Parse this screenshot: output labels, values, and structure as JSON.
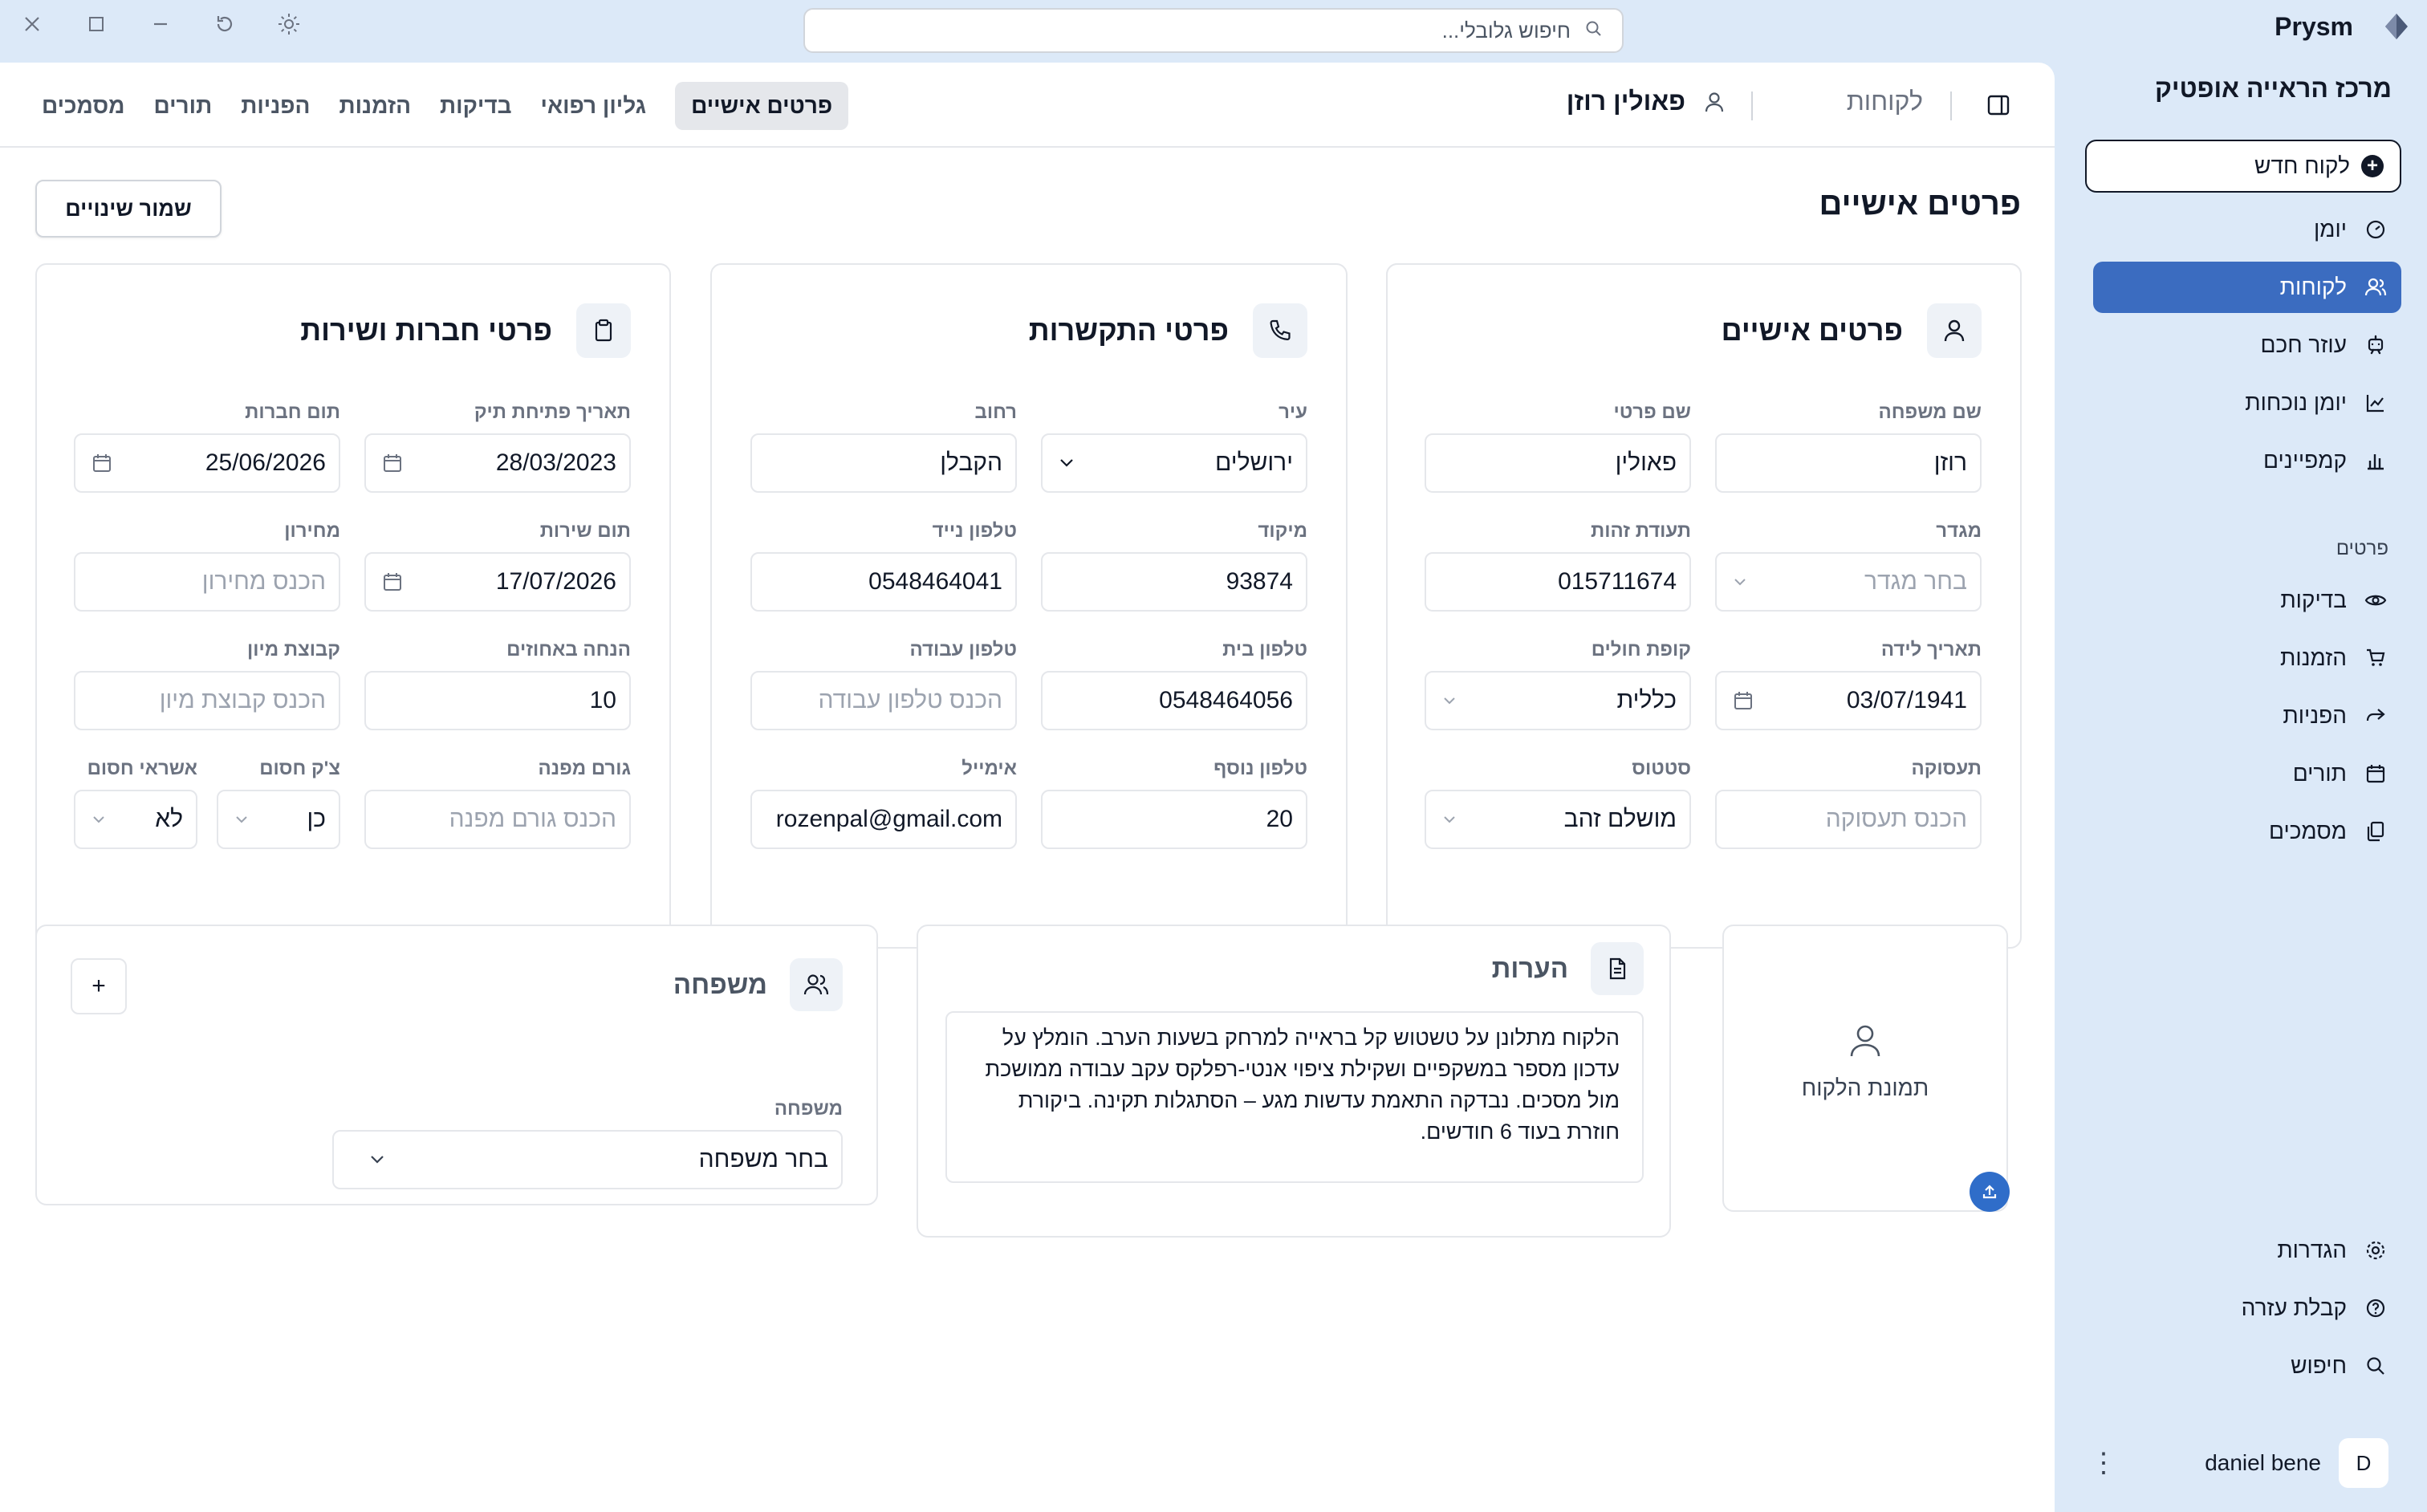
{
  "app": {
    "name": "Prysm"
  },
  "global_search": {
    "placeholder": "חיפוש גלובלי..."
  },
  "sidebar": {
    "clinic_name": "מרכז הראייה אופטיק",
    "new_client_label": "לקוח חדש",
    "nav": [
      {
        "label": "יומן",
        "icon": "gauge-icon"
      },
      {
        "label": "לקוחות",
        "icon": "users-icon",
        "active": true
      },
      {
        "label": "עוזר חכם",
        "icon": "bot-icon"
      },
      {
        "label": "יומן נוכחות",
        "icon": "chart-line-icon"
      },
      {
        "label": "קמפיינים",
        "icon": "bar-chart-icon"
      }
    ],
    "section_label": "פרטים",
    "details_nav": [
      {
        "label": "בדיקות",
        "icon": "eye-icon"
      },
      {
        "label": "הזמנות",
        "icon": "cart-icon"
      },
      {
        "label": "הפניות",
        "icon": "share-icon"
      },
      {
        "label": "תורים",
        "icon": "calendar-icon"
      },
      {
        "label": "מסמכים",
        "icon": "files-icon"
      }
    ],
    "bottom_nav": [
      {
        "label": "הגדרות",
        "icon": "gear-icon"
      },
      {
        "label": "קבלת עזרה",
        "icon": "help-icon"
      },
      {
        "label": "חיפוש",
        "icon": "search-icon"
      }
    ],
    "user": {
      "name": "daniel bene",
      "initial": "D"
    }
  },
  "topbar": {
    "section": "לקוחות",
    "client_name": "פאולין רוזן",
    "tabs": [
      "פרטים אישיים",
      "גליון רפואי",
      "בדיקות",
      "הזמנות",
      "הפניות",
      "תורים",
      "מסמכים"
    ],
    "active_tab": "פרטים אישיים"
  },
  "page": {
    "title": "פרטים אישיים",
    "save_label": "שמור שינויים"
  },
  "personal": {
    "title": "פרטים אישיים",
    "last_name": {
      "label": "שם משפחה",
      "value": "רוזן"
    },
    "first_name": {
      "label": "שם פרטי",
      "value": "פאולין"
    },
    "gender": {
      "label": "מגדר",
      "placeholder": "בחר מגדר"
    },
    "id_number": {
      "label": "תעודת זהות",
      "value": "015711674"
    },
    "birth_date": {
      "label": "תאריך לידה",
      "value": "03/07/1941"
    },
    "hmo": {
      "label": "קופת חולים",
      "value": "כללית"
    },
    "occupation": {
      "label": "תעסוקה",
      "placeholder": "הכנס תעסוקה"
    },
    "status": {
      "label": "סטטוס",
      "value": "מושלם זהב"
    }
  },
  "contact": {
    "title": "פרטי התקשרות",
    "city": {
      "label": "עיר",
      "value": "ירושלים"
    },
    "street": {
      "label": "רחוב",
      "value": "הקבלן"
    },
    "zip": {
      "label": "מיקוד",
      "value": "93874"
    },
    "mobile": {
      "label": "טלפון נייד",
      "value": "0548464041"
    },
    "home_phone": {
      "label": "טלפון בית",
      "value": "0548464056"
    },
    "work_phone": {
      "label": "טלפון עבודה",
      "placeholder": "הכנס טלפון עבודה"
    },
    "extra_phone": {
      "label": "טלפון נוסף",
      "value": "20"
    },
    "email": {
      "label": "אימייל",
      "value": "rozenpal@gmail.com"
    }
  },
  "membership": {
    "title": "פרטי חברות ושירות",
    "file_open_date": {
      "label": "תאריך פתיחת תיק",
      "value": "28/03/2023"
    },
    "membership_end": {
      "label": "תום חברות",
      "value": "25/06/2026"
    },
    "service_end": {
      "label": "תום שירות",
      "value": "17/07/2026"
    },
    "price_list": {
      "label": "מחירון",
      "placeholder": "הכנס מחירון"
    },
    "discount": {
      "label": "הנחה באחוזים",
      "value": "10"
    },
    "sort_group": {
      "label": "קבוצת מיון",
      "placeholder": "הכנס קבוצת מיון"
    },
    "referrer": {
      "label": "גורם מפנה",
      "placeholder": "הכנס גורם מפנה"
    },
    "blocked_check": {
      "label": "צ'ק חסום",
      "value": "כן"
    },
    "blocked_credit": {
      "label": "אשראי חסום",
      "value": "לא"
    }
  },
  "photo": {
    "label": "תמונת הלקוח"
  },
  "notes": {
    "title": "הערות",
    "text": "הלקוח מתלונן על טשטוש קל בראייה למרחק בשעות הערב. הומלץ על עדכון מספר במשקפיים ושקילת ציפוי אנטי-רפלקס עקב עבודה ממושכת מול מסכים. נבדקה התאמת עדשות מגע – הסתגלות תקינה. ביקורת חוזרת בעוד 6 חודשים."
  },
  "family": {
    "title": "משפחה",
    "add_label": "+",
    "select": {
      "label": "משפחה",
      "placeholder": "בחר משפחה"
    }
  },
  "colors": {
    "accent": "#3b6cc0",
    "background": "#dce9f8",
    "upload": "#2f6dc9"
  }
}
